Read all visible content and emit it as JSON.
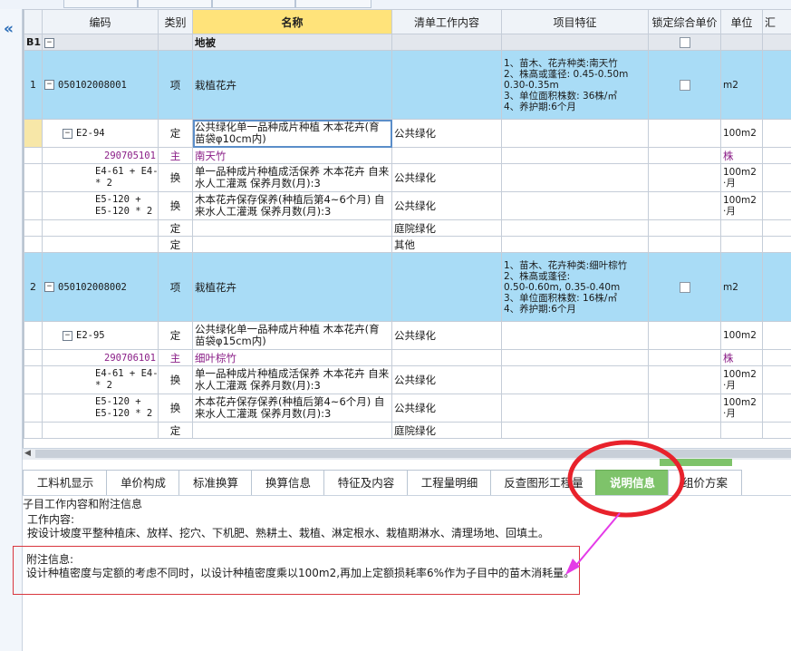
{
  "nav": {
    "collapse_glyph": "«"
  },
  "grid": {
    "headers": {
      "code": "编码",
      "category": "类别",
      "name": "名称",
      "content": "清单工作内容",
      "feature": "项目特征",
      "lock": "锁定综合单价",
      "unit": "单位",
      "summary": "汇"
    },
    "b1": {
      "label": "B1",
      "toggle": "−",
      "name": "地被"
    },
    "rows": [
      {
        "num": "1",
        "code": "050102008001",
        "category": "项",
        "name": "栽植花卉",
        "feature": "1、苗木、花卉种类:南天竹\n2、株高或蓬径: 0.45-0.50m\n0.30-0.35m\n3、单位面积株数: 36株/㎡\n4、养护期:6个月",
        "unit": "m2"
      },
      {
        "code": "E2-94",
        "category": "定",
        "name": "公共绿化单一品种成片种植 木本花卉(育苗袋φ10cm内)",
        "content": "公共绿化",
        "unit": "100m2"
      },
      {
        "code": "290705101",
        "category": "主",
        "name": "南天竹",
        "unit": "株"
      },
      {
        "code": "E4-61 + E4-61\n* 2",
        "category": "换",
        "name": "单一品种成片种植成活保养  木本花卉 自来水人工灌溉  保养月数(月):3",
        "content": "公共绿化",
        "unit": "100m2\n·月"
      },
      {
        "code": "E5-120 +\nE5-120 * 2",
        "category": "换",
        "name": "木本花卉保存保养(种植后第4~6个月) 自来水人工灌溉  保养月数(月):3",
        "content": "公共绿化",
        "unit": "100m2\n·月"
      },
      {
        "category": "定",
        "content": "庭院绿化"
      },
      {
        "category": "定",
        "content": "其他"
      },
      {
        "num": "2",
        "code": "050102008002",
        "category": "项",
        "name": "栽植花卉",
        "feature": "1、苗木、花卉种类:细叶棕竹\n2、株高或蓬径:\n0.50-0.60m, 0.35-0.40m\n3、单位面积株数: 16株/㎡\n4、养护期:6个月",
        "unit": "m2"
      },
      {
        "code": "E2-95",
        "category": "定",
        "name": "公共绿化单一品种成片种植 木本花卉(育苗袋φ15cm内)",
        "content": "公共绿化",
        "unit": "100m2"
      },
      {
        "code": "290706101",
        "category": "主",
        "name": "细叶棕竹",
        "unit": "株"
      },
      {
        "code": "E4-61 + E4-61\n* 2",
        "category": "换",
        "name": "单一品种成片种植成活保养  木本花卉 自来水人工灌溉  保养月数(月):3",
        "content": "公共绿化",
        "unit": "100m2\n·月"
      },
      {
        "code": "E5-120 +\nE5-120 * 2",
        "category": "换",
        "name": "木本花卉保存保养(种植后第4~6个月) 自来水人工灌溉  保养月数(月):3",
        "content": "公共绿化",
        "unit": "100m2\n·月"
      },
      {
        "category": "定",
        "content": "庭院绿化"
      }
    ]
  },
  "tabs": [
    "工料机显示",
    "单价构成",
    "标准换算",
    "换算信息",
    "特征及内容",
    "工程量明细",
    "反查图形工程量",
    "说明信息",
    "组价方案"
  ],
  "active_tab": "说明信息",
  "info": {
    "section_title": "子目工作内容和附注信息",
    "work_label": "工作内容:",
    "work_text": "按设计坡度平整种植床、放样、挖穴、下机肥、熟耕土、栽植、淋定根水、栽植期淋水、清理场地、回填土。",
    "note_label": "附注信息:",
    "note_text": "设计种植密度与定额的考虑不同时，以设计种植密度乘以100m2,再加上定额损耗率6%作为子目中的苗木消耗量。"
  },
  "colors": {
    "highlight_row": "#a9dcf6",
    "active_tab": "#7ec36a",
    "annotation": "#e8222c",
    "arrow": "#e43be8"
  }
}
